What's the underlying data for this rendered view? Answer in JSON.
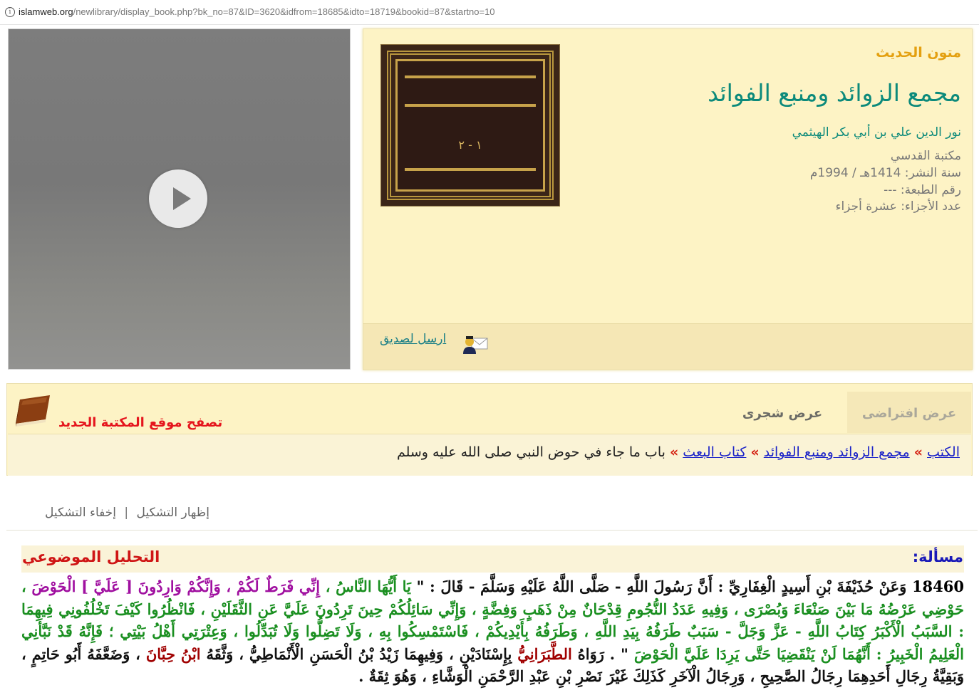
{
  "address_bar": {
    "domain": "islamweb.org",
    "path": "/newlibrary/display_book.php?bk_no=87&ID=3620&idfrom=18685&idto=18719&bookid=87&startno=10"
  },
  "video": {
    "play_icon": "play-icon"
  },
  "book": {
    "collection": "متون الحديث",
    "title": "مجمع الزوائد ومنبع الفوائد",
    "author": "نور الدين علي بن أبي بكر الهيثمي",
    "publisher": "مكتبة القدسي",
    "publish_year": "سنة النشر: 1414هـ / 1994م",
    "edition": "رقم الطبعة: ---",
    "volumes": "عدد الأجزاء: عشرة أجزاء",
    "cover_volume": "١ - ٢",
    "send_friend": "ارسل لصديق"
  },
  "nav": {
    "tab_virtual": "عرض افتراضى",
    "tab_tree": "عرض شجرى",
    "new_site": "تصفح موقع المكتبة الجديد",
    "breadcrumb": [
      {
        "label": "الكتب",
        "link": true
      },
      {
        "label": "مجمع الزوائد ومنبع الفوائد",
        "link": true
      },
      {
        "label": "كتاب البعث",
        "link": true
      },
      {
        "label": "باب ما جاء في حوض النبي صلى الله عليه وسلم",
        "link": false
      }
    ],
    "separator": "»"
  },
  "diacritics": {
    "show": "إظهار التشكيل",
    "divider": "|",
    "hide": "إخفاء التشكيل"
  },
  "content": {
    "masala_label": "مسألة:",
    "analysis_label": "التحليل الموضوعي",
    "hadith_number": "18460",
    "hadith": {
      "p1": "وَعَنْ حُذَيْفَةَ بْنِ أَسِيدٍ الْغِفَارِيِّ : أَنَّ رَسُولَ اللَّهِ - صَلَّى اللَّهُ عَلَيْهِ وَسَلَّمَ - قَالَ : \" ",
      "p2": "يَا أَيُّهَا النَّاسُ ، ",
      "p3": "إِنِّي فَرَطٌ لَكُمْ ، وَإِنَّكُمْ وَارِدُونَ [ عَلَيَّ ] الْحَوْضَ",
      "p4": " ، حَوْضِي عَرْضُهُ مَا بَيْنَ صَنْعَاءَ وَبُصْرَى ، وَفِيهِ عَدَدُ النُّجُومِ قِدْحَانٌ مِنْ ذَهَبٍ وَفِضَّةٍ ، وَإِنِّي سَائِلُكُمْ حِينَ تَرِدُونَ عَلَيَّ عَنِ الثَّقَلَيْنِ ، فَانْظُرُوا كَيْفَ تَخْلُفُونِي فِيهِمَا : السَّبَبُ الْأَكْبَرُ كِتَابُ اللَّهِ - عَزَّ وَجَلَّ - سَبَبٌ طَرَفُهُ بِيَدِ اللَّهِ ، وَطَرَفُهُ بِأَيْدِيكُمْ ، فَاسْتَمْسِكُوا بِهِ ، وَلَا تَضِلُّوا وَلَا تُبَدِّلُوا ، وَعِتْرَتِي أَهْلُ بَيْتِي ؛ فَإِنَّهُ قَدْ نَبَّأَنِي الْعَلِيمُ الْخَبِيرُ : أَنَّهُمَا لَنْ يَنْقَضِيَا حَتَّى يَرِدَا عَلَيَّ الْحَوْضَ",
      "p5": " \" . رَوَاهُ ",
      "p6": "الطَّبَرَانِيُّ",
      "p7": " بِإِسْنَادَيْنِ ، وَفِيهِمَا زَيْدُ بْنُ الْحَسَنِ الْأَنْمَاطِيُّ ، وَثَّقَهُ ",
      "p8": "ابْنُ حِبَّانَ",
      "p9": " ، وَضَعَّفَهُ أَبُو حَاتِمٍ ، وَبَقِيَّةُ رِجَالِ أَحَدِهِمَا رِجَالُ الصَّحِيحِ ، وَرِجَالُ الْآخَرِ كَذَلِكَ غَيْرَ نَصْرِ بْنِ عَبْدِ الرَّحْمَنِ الْوَشَّاءِ ، وَهُوَ ثِقَةٌ ."
    }
  },
  "colors": {
    "panel_bg": "#fdf3c5",
    "title_teal": "#0c8a7b",
    "collection_orange": "#e4a010",
    "link_blue": "#1a22c8",
    "quote_green": "#1a8f20",
    "quote_purple": "#a010a0",
    "highlight_red": "#cf1515"
  }
}
